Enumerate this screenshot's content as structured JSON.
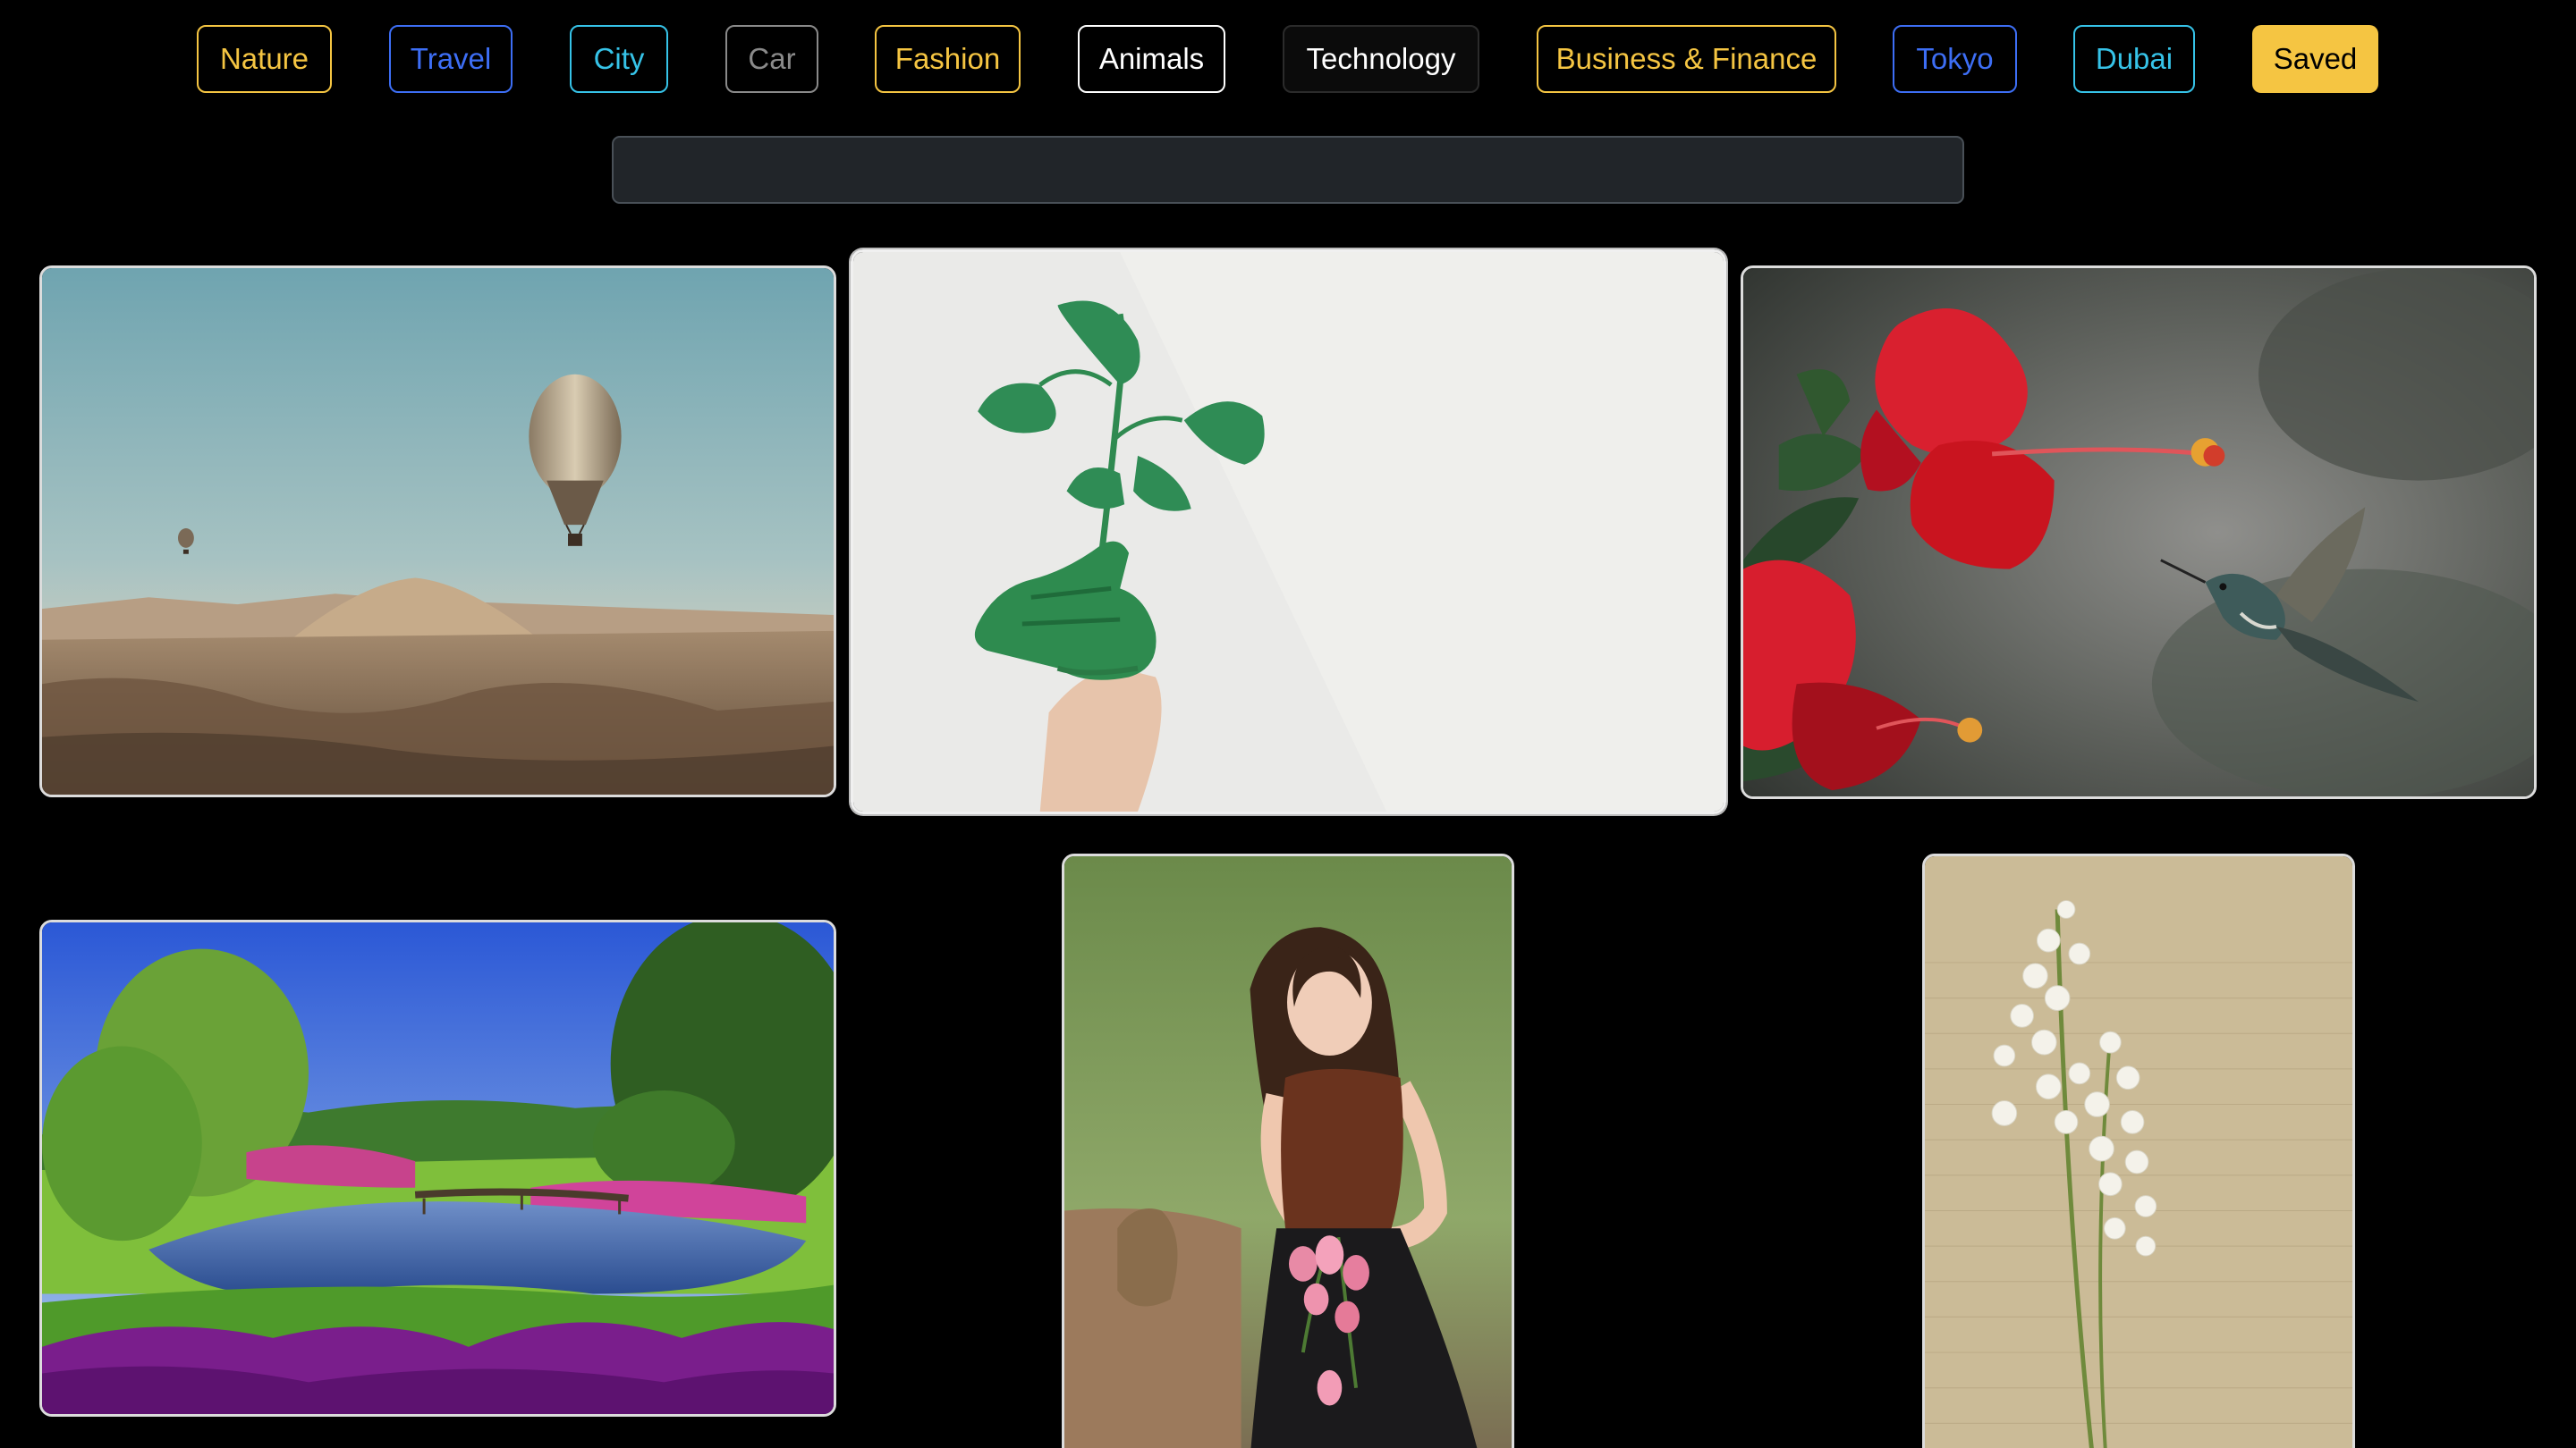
{
  "categories": [
    {
      "label": "Nature",
      "color": "#f5c542",
      "style": "outline"
    },
    {
      "label": "Travel",
      "color": "#3d6ef5",
      "style": "outline"
    },
    {
      "label": "City",
      "color": "#36c3e8",
      "style": "outline"
    },
    {
      "label": "Car",
      "color": "#8a8a8a",
      "style": "outline"
    },
    {
      "label": "Fashion",
      "color": "#f5c542",
      "style": "outline"
    },
    {
      "label": "Animals",
      "color": "#ffffff",
      "style": "outline"
    },
    {
      "label": "Technology",
      "color": "#ffffff",
      "style": "dark"
    },
    {
      "label": "Business & Finance",
      "color": "#f5c542",
      "style": "outline"
    },
    {
      "label": "Tokyo",
      "color": "#3d6ef5",
      "style": "outline"
    },
    {
      "label": "Dubai",
      "color": "#36c3e8",
      "style": "outline"
    },
    {
      "label": "Saved",
      "color": "#000000",
      "background": "#f5c542",
      "style": "filled"
    }
  ],
  "search": {
    "value": "",
    "placeholder": ""
  },
  "gallery": {
    "images": [
      {
        "subject": "hot-air-balloons-over-valley"
      },
      {
        "subject": "green-painted-hand-holding-plant"
      },
      {
        "subject": "hibiscus-and-hummingbird"
      },
      {
        "subject": "garden-pond-with-bridge"
      },
      {
        "subject": "woman-holding-pink-tulips"
      },
      {
        "subject": "lily-of-the-valley-on-paper"
      }
    ]
  }
}
